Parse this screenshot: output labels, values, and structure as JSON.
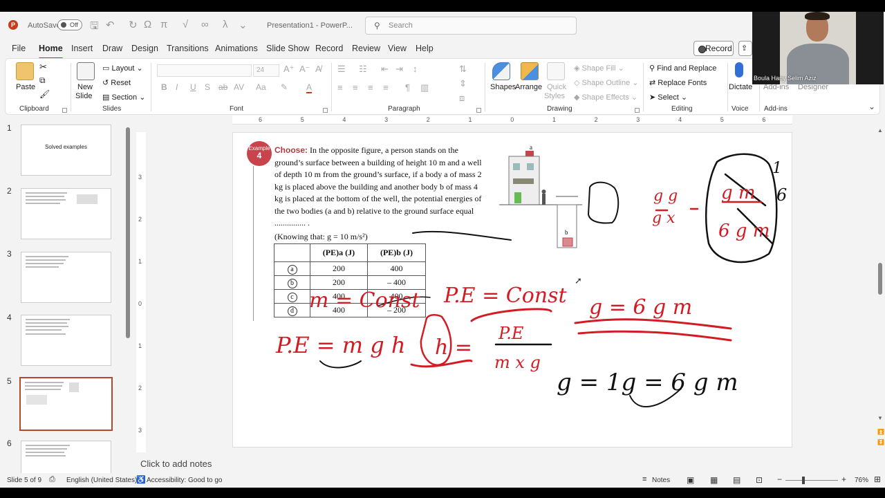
{
  "app": {
    "logo": "P",
    "autosave_label": "AutoSave",
    "autosave_state": "Off",
    "doc_title": "Presentation1 - PowerP...",
    "search_placeholder": "Search",
    "accent_color": "#c43e1c"
  },
  "menu": {
    "tabs": [
      "File",
      "Home",
      "Insert",
      "Draw",
      "Design",
      "Transitions",
      "Animations",
      "Slide Show",
      "Record",
      "Review",
      "View",
      "Help"
    ],
    "active": "Home",
    "record_label": "Record"
  },
  "ribbon": {
    "clipboard": {
      "label": "Clipboard",
      "paste": "Paste"
    },
    "slides": {
      "label": "Slides",
      "new_slide_1": "New",
      "new_slide_2": "Slide",
      "layout": "Layout",
      "reset": "Reset",
      "section": "Section"
    },
    "font": {
      "label": "Font",
      "size": "24"
    },
    "paragraph": {
      "label": "Paragraph"
    },
    "drawing": {
      "label": "Drawing",
      "shapes": "Shapes",
      "arrange": "Arrange",
      "quick_styles_1": "Quick",
      "quick_styles_2": "Styles",
      "shape_fill": "Shape Fill",
      "shape_outline": "Shape Outline",
      "shape_effects": "Shape Effects"
    },
    "editing": {
      "label": "Editing",
      "find_replace": "Find and Replace",
      "replace_fonts": "Replace Fonts",
      "select": "Select"
    },
    "voice": {
      "label": "Voice",
      "dictate": "Dictate"
    },
    "addins": {
      "label": "Add-ins",
      "addins_btn": "Add-ins",
      "designer": "Designer"
    }
  },
  "thumbnails": [
    {
      "num": "1",
      "title": "Solved examples"
    },
    {
      "num": "2"
    },
    {
      "num": "3"
    },
    {
      "num": "4"
    },
    {
      "num": "5",
      "selected": true
    },
    {
      "num": "6"
    }
  ],
  "ruler": {
    "h_ticks": [
      "6",
      "5",
      "4",
      "3",
      "2",
      "1",
      "0",
      "1",
      "2",
      "3",
      "4",
      "5",
      "6"
    ],
    "v_ticks": [
      "3",
      "2",
      "1",
      "0",
      "1",
      "2",
      "3"
    ]
  },
  "slide": {
    "badge_1": "Example",
    "badge_2": "4",
    "choose": "Choose:",
    "question": "In the opposite figure, a person stands on the ground’s surface between a building of height 10 m and a well of depth 10 m from the ground’s surface, if a body a of mass 2 kg is placed above the building and another body b of mass 4 kg is placed at the bottom of the well, the potential energies of the two bodies (a and b) relative to the ground surface equal ............... .",
    "knowing": "(Knowing that: g = 10 m/s²)",
    "table_header_a": "(PE)a (J)",
    "table_header_b": "(PE)b (J)",
    "rows": [
      {
        "opt": "a",
        "a": "200",
        "b": "400"
      },
      {
        "opt": "b",
        "a": "200",
        "b": "– 400"
      },
      {
        "opt": "c",
        "a": "400",
        "b": "400"
      },
      {
        "opt": "d",
        "a": "400",
        "b": "– 200"
      }
    ],
    "fig_label_a": "a",
    "fig_label_b": "b",
    "ink": {
      "gg_top": "g g",
      "gg_bot": "g x",
      "frac_top": "g m",
      "frac_bot": "6 g m",
      "one_sixth_1": "1",
      "one_sixth_2": "6",
      "pe_const": "P.E = Const",
      "m_const": "m = Const",
      "ge_6gm": "g = 6 g m",
      "pe_mgh": "P.E = m g h",
      "h_eq": "h =",
      "pe_frac_top": "P.E",
      "pe_frac_bot": "m x g",
      "ge_1g_6gm": "g = 1g = 6 g m"
    }
  },
  "notes_placeholder": "Click to add notes",
  "status": {
    "slide": "Slide 5 of 9",
    "language": "English (United States)",
    "accessibility": "Accessibility: Good to go",
    "notes": "Notes",
    "zoom": "76%"
  },
  "webcam": {
    "name": "Boula Hany Selim Aziz"
  }
}
